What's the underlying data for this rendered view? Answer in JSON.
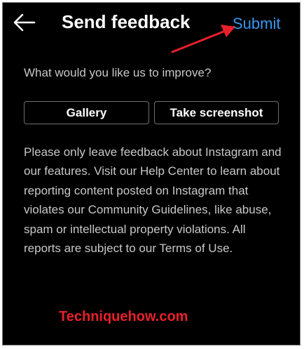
{
  "header": {
    "title": "Send feedback",
    "submit_label": "Submit",
    "back_icon": "arrow-left-icon"
  },
  "form": {
    "prompt": "What would you like us to improve?",
    "gallery_label": "Gallery",
    "screenshot_label": "Take screenshot"
  },
  "info_text": "Please only leave feedback about Instagram and our features. Visit our Help Center to learn about reporting content posted on Instagram that violates our Community Guidelines, like abuse, spam or intellectual property violations. All reports are subject to our Terms of Use.",
  "watermark": "Techniquehow.com",
  "colors": {
    "background": "#000000",
    "text": "#ffffff",
    "secondary_text": "#c8c8c8",
    "accent": "#3897f0",
    "annotation": "#e8202a",
    "button_border": "#6e6e6e"
  }
}
